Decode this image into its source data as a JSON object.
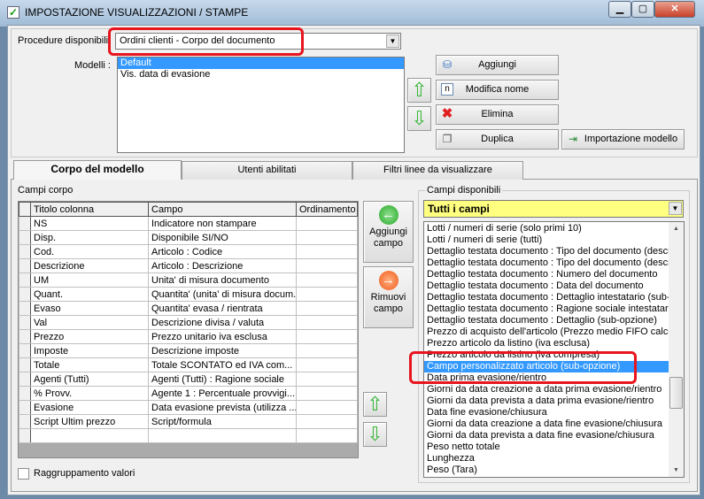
{
  "window": {
    "title": "IMPOSTAZIONE VISUALIZZAZIONI / STAMPE",
    "controls": [
      "minimize",
      "maximize",
      "close"
    ]
  },
  "procedure": {
    "label": "Procedure disponibili",
    "value": "Ordini clienti - Corpo del documento"
  },
  "modelli": {
    "label": "Modelli :",
    "items": [
      "Default",
      "Vis. data di evasione"
    ],
    "selected": "Default"
  },
  "buttons": {
    "aggiungi": "Aggiungi",
    "modifica": "Modifica nome",
    "elimina": "Elimina",
    "duplica": "Duplica",
    "importazione": "Importazione modello",
    "aggiungi_campo": "Aggiungi campo",
    "rimuovi_campo": "Rimuovi campo"
  },
  "tabs": [
    {
      "label": "Corpo del modello",
      "active": true
    },
    {
      "label": "Utenti abilitati"
    },
    {
      "label": "Filtri linee da visualizzare"
    }
  ],
  "campi_corpo": {
    "label": "Campi corpo",
    "columns": [
      "Titolo colonna",
      "Campo",
      "Ordinamento"
    ],
    "rows": [
      [
        "NS",
        "Indicatore non stampare",
        ""
      ],
      [
        "Disp.",
        "Disponibile SI/NO",
        ""
      ],
      [
        "Cod.",
        "Articolo : Codice",
        ""
      ],
      [
        "Descrizione",
        "Articolo : Descrizione",
        ""
      ],
      [
        "UM",
        "Unita' di misura documento",
        ""
      ],
      [
        "Quant.",
        "Quantita' (unita' di misura docum...",
        ""
      ],
      [
        "Evaso",
        "Quantita' evasa / rientrata",
        ""
      ],
      [
        "Val",
        "Descrizione divisa / valuta",
        ""
      ],
      [
        "Prezzo",
        "Prezzo unitario iva esclusa",
        ""
      ],
      [
        "Imposte",
        "Descrizione imposte",
        ""
      ],
      [
        "Totale",
        "Totale SCONTATO ed IVA com...",
        ""
      ],
      [
        "Agenti (Tutti)",
        "Agenti (Tutti) : Ragione sociale",
        ""
      ],
      [
        "% Provv.",
        "Agente 1 : Percentuale provvigi...",
        ""
      ],
      [
        "Evasione",
        "Data evasione prevista (utilizza ...",
        ""
      ],
      [
        "Script Ultim prezzo",
        "Script/formula",
        ""
      ],
      [
        "",
        "",
        ""
      ]
    ]
  },
  "raggruppamento": {
    "label": "Raggruppamento valori",
    "checked": false
  },
  "campi_disponibili": {
    "label": "Campi disponibili",
    "filter": "Tutti i campi",
    "filter_color": "#ffff80",
    "items": [
      "Lotti / numeri di serie (solo primi 10)",
      "Lotti / numeri di serie (tutti)",
      "Dettaglio testata documento : Tipo del documento (descrizione)",
      "Dettaglio testata documento : Tipo del documento (descrizione)",
      "Dettaglio testata documento : Numero del documento",
      "Dettaglio testata documento : Data del documento",
      "Dettaglio testata documento : Dettaglio intestatario (sub-opzione)",
      "Dettaglio testata documento : Ragione sociale intestatario",
      "Dettaglio testata documento : Dettaglio (sub-opzione)",
      "Prezzo di acquisto dell'articolo (Prezzo medio FIFO calcolato)",
      "Prezzo articolo da listino (iva esclusa)",
      "Prezzo articolo da listino (iva compresa)",
      "Campo personalizzato articolo (sub-opzione)",
      "Data prima evasione/rientro",
      "Giorni da data creazione a data prima evasione/rientro",
      "Giorni da data prevista a data prima evasione/rientro",
      "Data fine evasione/chiusura",
      "Giorni da data creazione a data fine evasione/chiusura",
      "Giorni da data prevista a data fine evasione/chiusura",
      "Peso netto totale",
      "Lunghezza",
      "Peso (Tara)"
    ],
    "selected_index": 12
  },
  "colors": {
    "selection": "#3399ff",
    "highlight": "#e8141e",
    "arrow": "#3cb83c"
  }
}
